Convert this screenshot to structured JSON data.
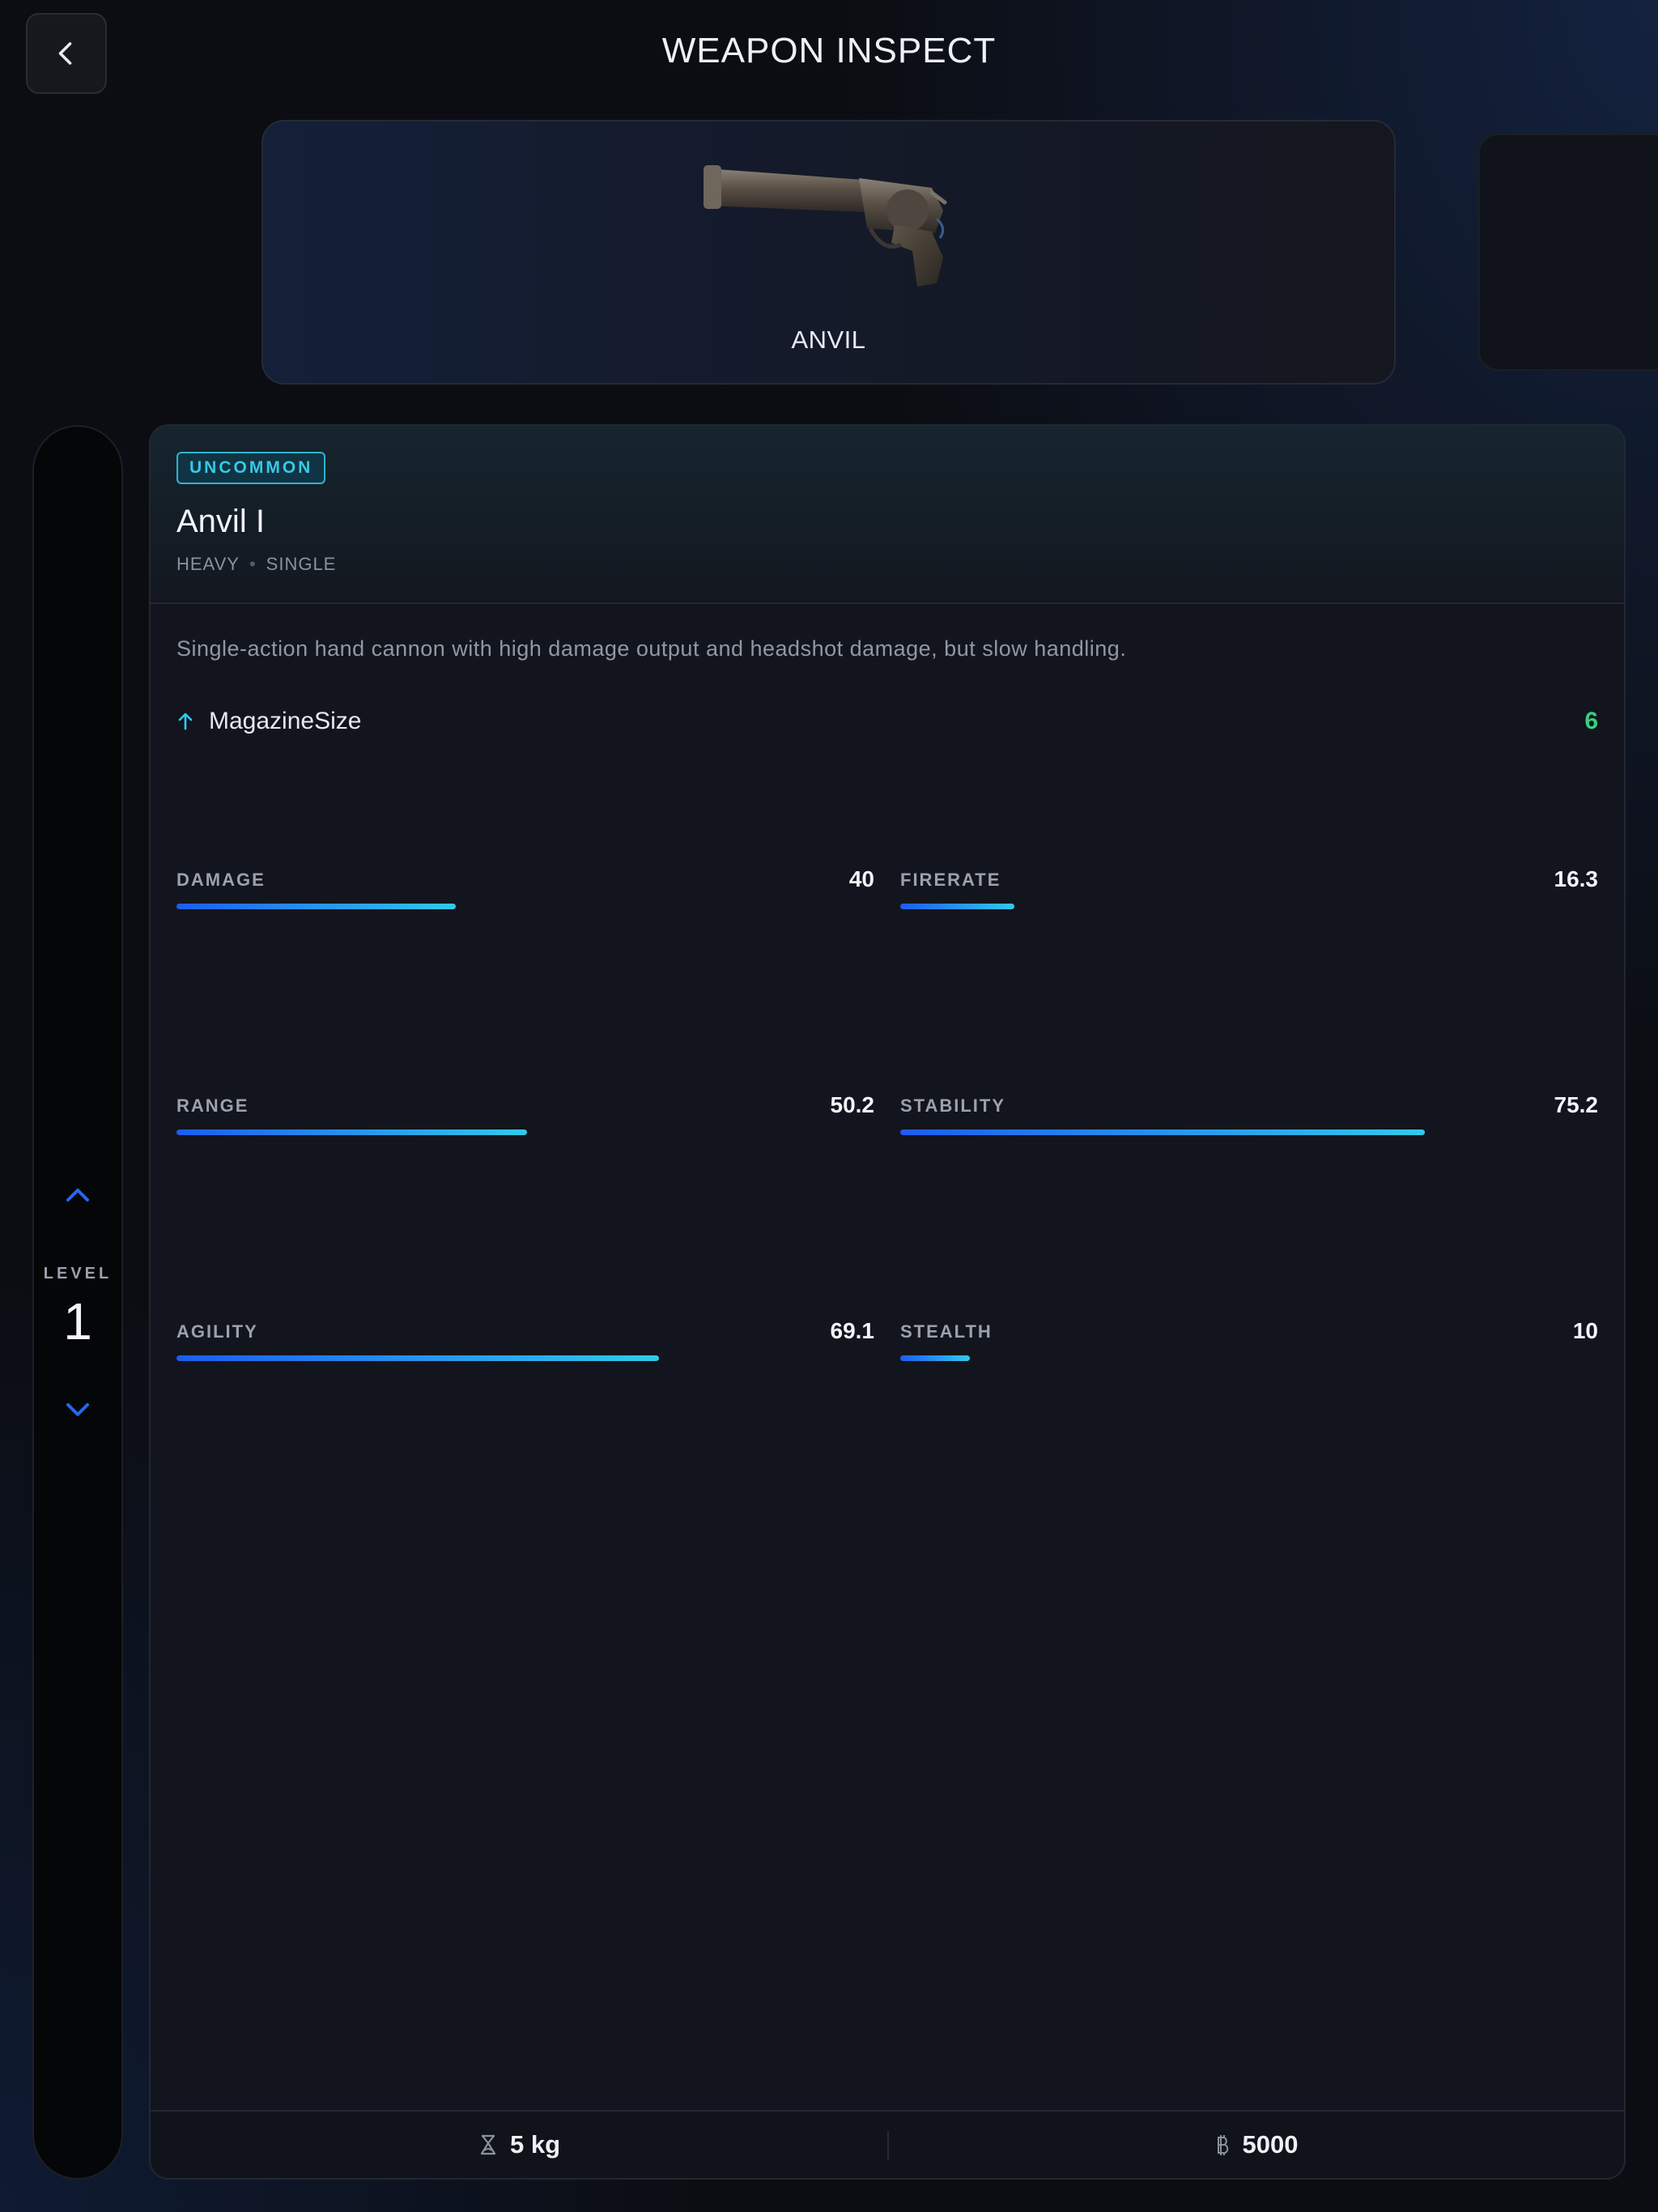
{
  "header": {
    "title": "WEAPON INSPECT",
    "back_icon": "chevron-left-icon"
  },
  "carousel": {
    "active": {
      "name": "ANVIL",
      "image": "revolver-hand-cannon-image"
    }
  },
  "level": {
    "label": "LEVEL",
    "value": "1"
  },
  "item": {
    "rarity": "UNCOMMON",
    "rarity_color": "#38c9e6",
    "name": "Anvil I",
    "class": "HEAVY",
    "fire_mode": "SINGLE",
    "description": "Single-action hand cannon with high damage output and headshot damage, but slow handling.",
    "modifier": {
      "label": "MagazineSize",
      "value": "6",
      "direction": "up",
      "color": "#35d07f"
    }
  },
  "stats": [
    {
      "name": "DAMAGE",
      "value": "40",
      "fill": 0.4
    },
    {
      "name": "FIRERATE",
      "value": "16.3",
      "fill": 0.163
    },
    {
      "name": "RANGE",
      "value": "50.2",
      "fill": 0.502
    },
    {
      "name": "STABILITY",
      "value": "75.2",
      "fill": 0.752
    },
    {
      "name": "AGILITY",
      "value": "69.1",
      "fill": 0.691
    },
    {
      "name": "STEALTH",
      "value": "10",
      "fill": 0.1
    }
  ],
  "footer": {
    "weight": {
      "icon": "weight-icon",
      "value": "5 kg"
    },
    "price": {
      "icon": "currency-icon",
      "value": "5000"
    }
  },
  "colors": {
    "bar_start": "#1d5cf2",
    "bar_end": "#2fcbea",
    "background": "#0b0d12"
  }
}
